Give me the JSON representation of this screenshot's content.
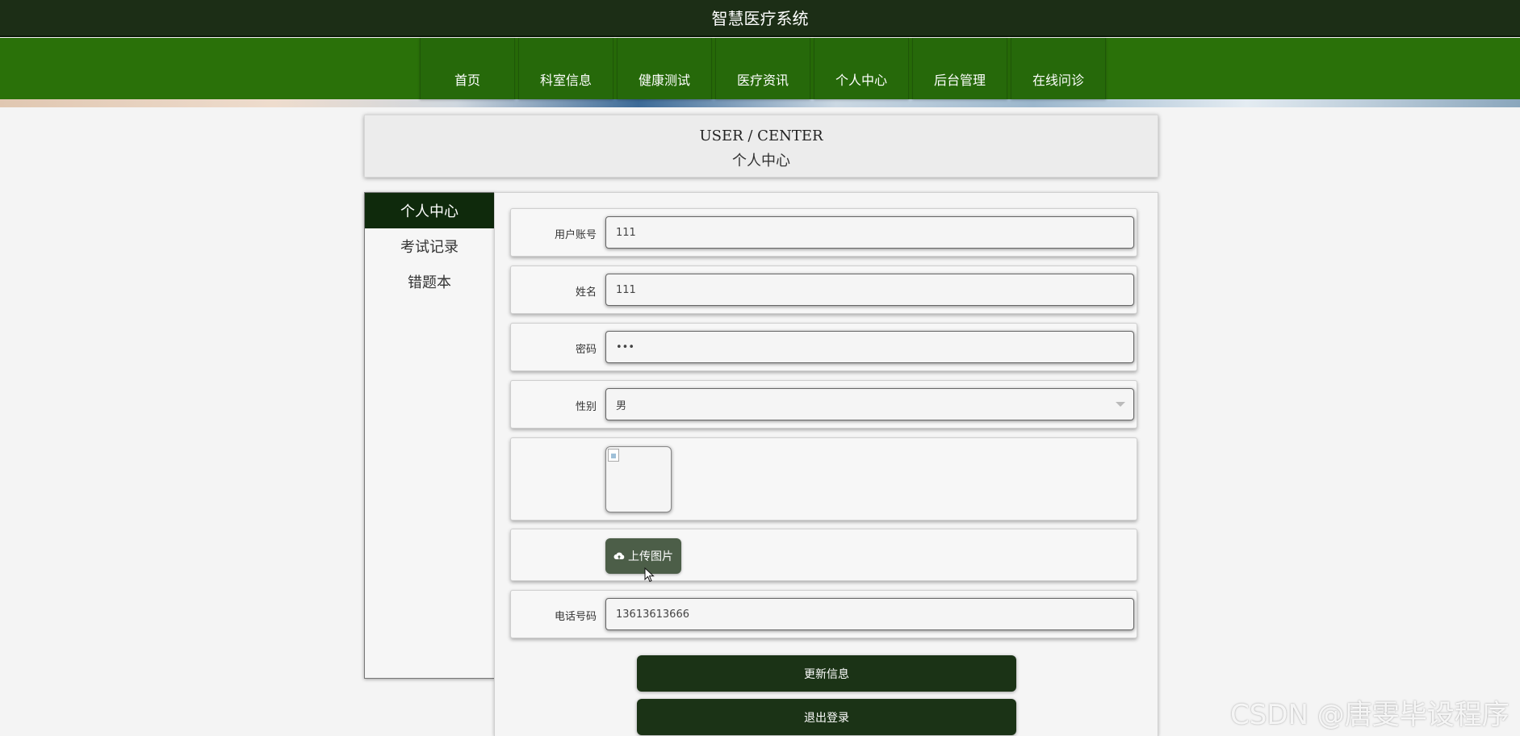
{
  "header": {
    "title": "智慧医疗系统"
  },
  "nav": {
    "items": [
      "首页",
      "科室信息",
      "健康测试",
      "医疗资讯",
      "个人中心",
      "后台管理",
      "在线问诊"
    ]
  },
  "banner": {
    "en": "USER / CENTER",
    "cn": "个人中心"
  },
  "sidebar": {
    "items": [
      "个人中心",
      "考试记录",
      "错题本"
    ]
  },
  "form": {
    "account_label": "用户账号",
    "account_value": "111",
    "name_label": "姓名",
    "name_value": "111",
    "password_label": "密码",
    "password_value": "•••",
    "gender_label": "性别",
    "gender_value": "男",
    "upload_label": "上传图片",
    "phone_label": "电话号码",
    "phone_value": "13613613666"
  },
  "buttons": {
    "update": "更新信息",
    "logout": "退出登录"
  },
  "watermark": "CSDN @唐雯毕设程序",
  "colors": {
    "header_bg": "#1c2e16",
    "nav_bg": "#2a7109",
    "active_sidebar": "#0f2a0c",
    "button_bg": "#1b3316",
    "upload_bg": "#4c5e48"
  }
}
